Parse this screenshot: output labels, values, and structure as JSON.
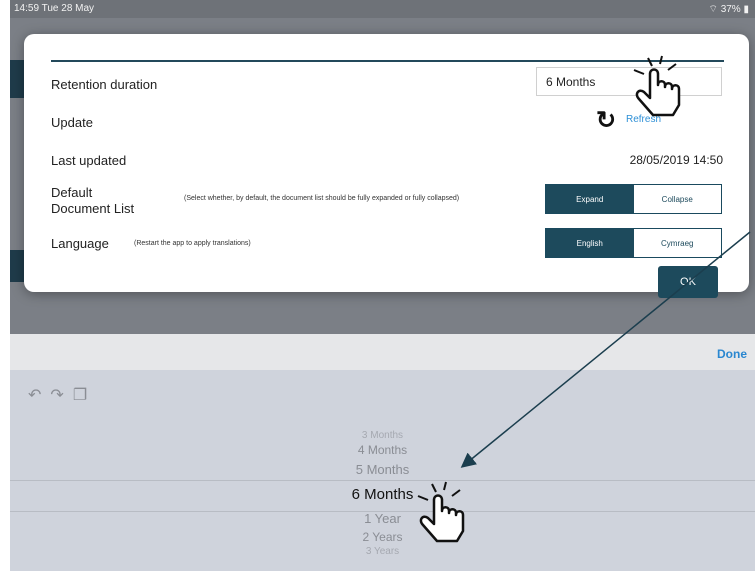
{
  "status_bar": {
    "time": "14:59  Tue 28 May",
    "indicators": "37%"
  },
  "dialog": {
    "retention": {
      "label": "Retention duration",
      "value": "6 Months"
    },
    "update": {
      "label": "Update",
      "action": "Refresh"
    },
    "last_updated": {
      "label": "Last updated",
      "value": "28/05/2019 14:50"
    },
    "document_list": {
      "label_line1": "Default",
      "label_line2": "Document List",
      "hint": "(Select whether, by default, the document list should be fully expanded or fully collapsed)",
      "options": [
        "Expand",
        "Collapse"
      ],
      "selected": "Expand"
    },
    "language": {
      "label": "Language",
      "hint": "(Restart the app to apply translations)",
      "options": [
        "English",
        "Cymraeg"
      ],
      "selected": "English"
    },
    "ok_label": "OK"
  },
  "keyboard_toolbar": {
    "done_label": "Done"
  },
  "picker": {
    "items": [
      "3 Months",
      "4 Months",
      "5 Months",
      "6 Months",
      "1 Year",
      "2 Years",
      "3 Years"
    ],
    "selected": "6 Months"
  },
  "colors": {
    "accent": "#1d4a5c",
    "link": "#2d8fd6"
  }
}
